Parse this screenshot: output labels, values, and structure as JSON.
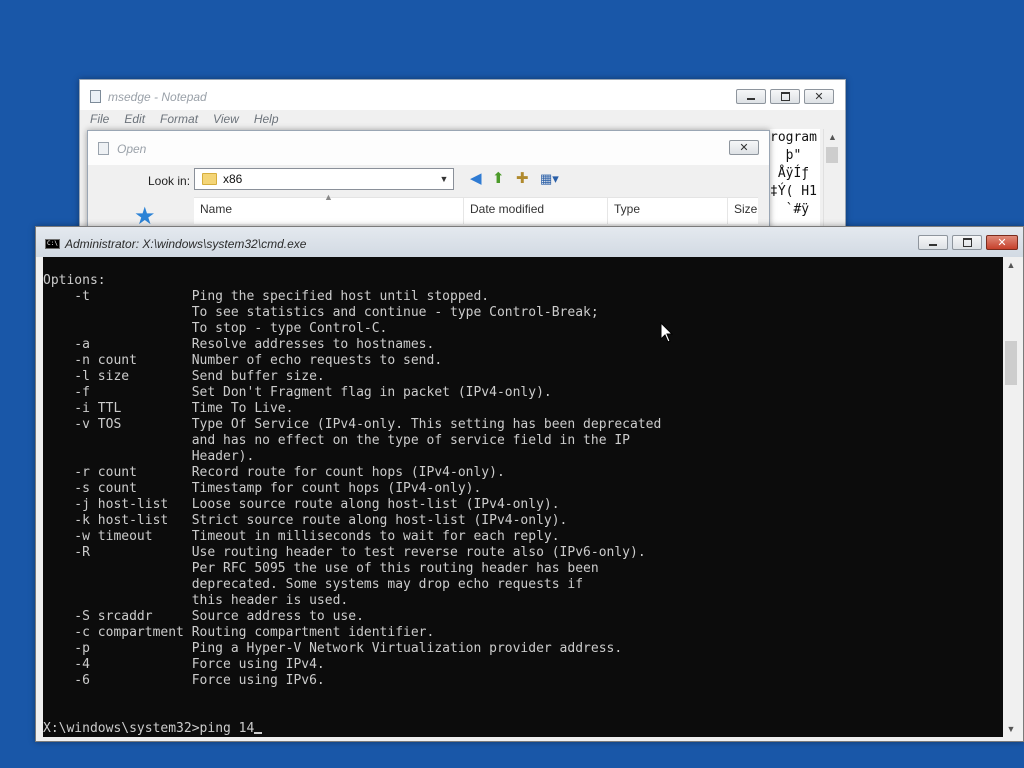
{
  "notepad": {
    "title": "msedge - Notepad",
    "menu": [
      "File",
      "Edit",
      "Format",
      "View",
      "Help"
    ],
    "text_lines": [
      "rogram",
      "  þ\"",
      " ÅÿÍƒ",
      "‡Ý( H1",
      "  `#ÿ"
    ]
  },
  "open_dialog": {
    "title": "Open",
    "look_in_label": "Look in:",
    "look_in_value": "x86",
    "columns": [
      "Name",
      "Date modified",
      "Type",
      "Size"
    ]
  },
  "cmd": {
    "title": "Administrator: X:\\windows\\system32\\cmd.exe",
    "output": "Options:\n    -t             Ping the specified host until stopped.\n                   To see statistics and continue - type Control-Break;\n                   To stop - type Control-C.\n    -a             Resolve addresses to hostnames.\n    -n count       Number of echo requests to send.\n    -l size        Send buffer size.\n    -f             Set Don't Fragment flag in packet (IPv4-only).\n    -i TTL         Time To Live.\n    -v TOS         Type Of Service (IPv4-only. This setting has been deprecated\n                   and has no effect on the type of service field in the IP\n                   Header).\n    -r count       Record route for count hops (IPv4-only).\n    -s count       Timestamp for count hops (IPv4-only).\n    -j host-list   Loose source route along host-list (IPv4-only).\n    -k host-list   Strict source route along host-list (IPv4-only).\n    -w timeout     Timeout in milliseconds to wait for each reply.\n    -R             Use routing header to test reverse route also (IPv6-only).\n                   Per RFC 5095 the use of this routing header has been\n                   deprecated. Some systems may drop echo requests if\n                   this header is used.\n    -S srcaddr     Source address to use.\n    -c compartment Routing compartment identifier.\n    -p             Ping a Hyper-V Network Virtualization provider address.\n    -4             Force using IPv4.\n    -6             Force using IPv6.",
    "prompt": "X:\\windows\\system32>",
    "input": "ping 14"
  },
  "colors": {
    "desktop": "#1957a8",
    "console_bg": "#0c0c0c",
    "console_fg": "#cccccc"
  },
  "icons": [
    "notepad-icon",
    "minimize-icon",
    "maximize-icon",
    "close-icon",
    "folder-icon",
    "back-icon",
    "up-folder-icon",
    "new-folder-icon",
    "view-menu-icon",
    "star-icon",
    "cmd-icon",
    "mouse-pointer-icon"
  ]
}
